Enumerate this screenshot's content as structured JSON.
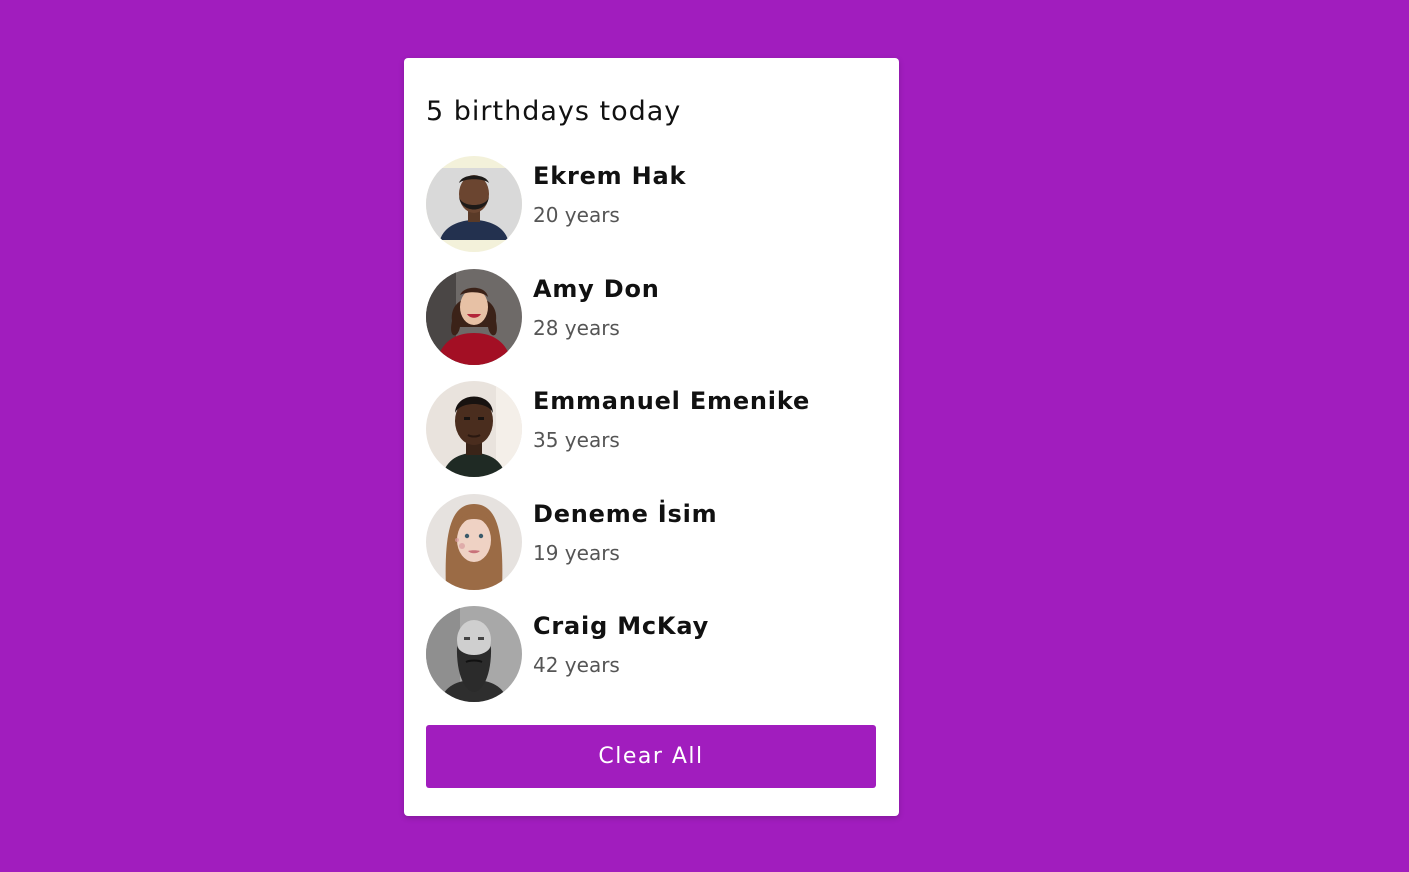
{
  "header": {
    "title": "5 birthdays today"
  },
  "people": [
    {
      "name": "Ekrem Hak",
      "age": "20 years"
    },
    {
      "name": "Amy Don",
      "age": "28 years"
    },
    {
      "name": "Emmanuel Emenike",
      "age": "35 years"
    },
    {
      "name": "Deneme İsim",
      "age": "19 years"
    },
    {
      "name": "Craig McKay",
      "age": "42 years"
    }
  ],
  "actions": {
    "clear_label": "Clear All"
  },
  "colors": {
    "background": "#a11dbe",
    "button": "#a11dbe",
    "card": "#ffffff"
  }
}
